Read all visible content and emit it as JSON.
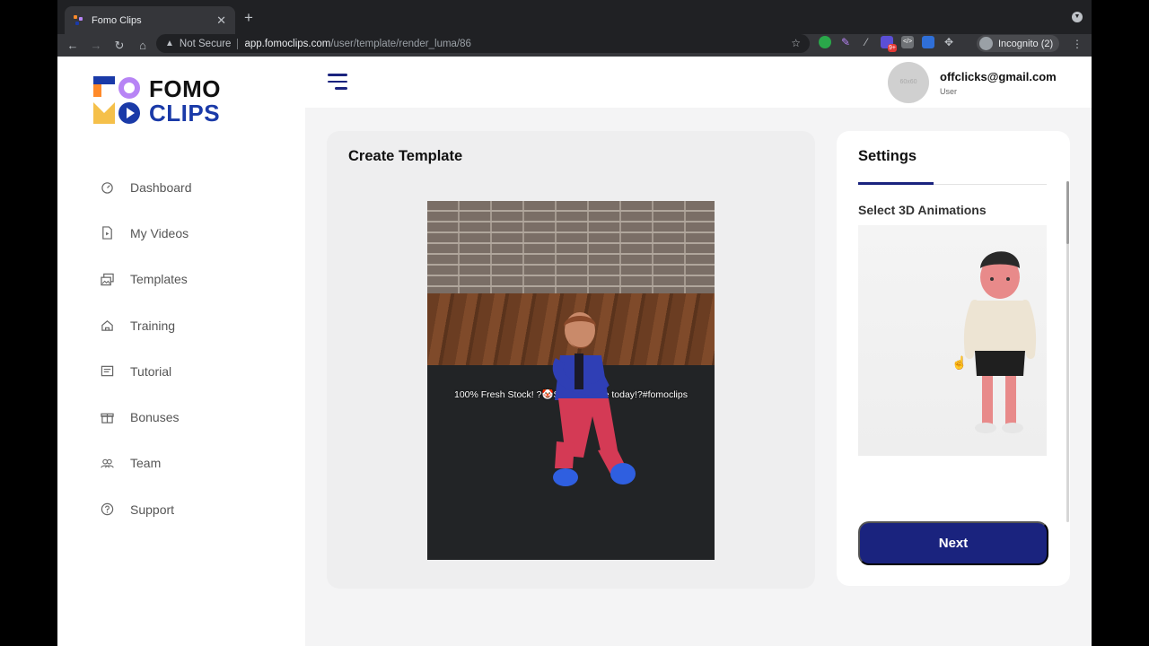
{
  "browser": {
    "tab_title": "Fomo Clips",
    "tab_close": "✕",
    "new_tab": "+",
    "security_label": "Not Secure",
    "url_host": "app.fomoclips.com",
    "url_path": "/user/template/render_luma/86",
    "incognito_label": "Incognito (2)",
    "extension_badge": "9+"
  },
  "logo": {
    "line1": "FOMO",
    "line2": "CLIPS"
  },
  "sidebar": {
    "items": [
      {
        "label": "Dashboard",
        "icon": "gauge-icon"
      },
      {
        "label": "My Videos",
        "icon": "video-file-icon"
      },
      {
        "label": "Templates",
        "icon": "images-icon"
      },
      {
        "label": "Training",
        "icon": "training-icon"
      },
      {
        "label": "Tutorial",
        "icon": "tutorial-icon"
      },
      {
        "label": "Bonuses",
        "icon": "gift-icon"
      },
      {
        "label": "Team",
        "icon": "team-icon"
      },
      {
        "label": "Support",
        "icon": "help-icon"
      }
    ]
  },
  "header": {
    "avatar_placeholder": "60x60",
    "user_email": "offclicks@gmail.com",
    "user_role": "User"
  },
  "create_template": {
    "title": "Create Template",
    "video_caption": "100% Fresh Stock! ?🤡Shop change today!?#fomoclips"
  },
  "settings": {
    "title": "Settings",
    "section_label": "Select 3D Animations",
    "next_label": "Next"
  },
  "colors": {
    "accent": "#1a237e",
    "logo_blue": "#1a3aa8",
    "logo_purple": "#b784f5",
    "logo_orange": "#ff8a2a",
    "logo_yellow": "#f5c04a"
  }
}
